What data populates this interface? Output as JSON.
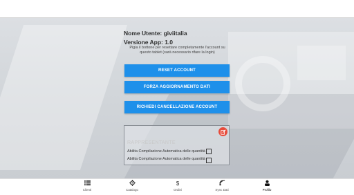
{
  "profile": {
    "username_line": "Nome Utente: giviitalia",
    "version_line": "Versione App: 1.0",
    "note": "Pigia il bottone per resettare completamente l'account su questo tablet (sarà necessario rifare la login)"
  },
  "actions": {
    "reset": "RESET ACCOUNT",
    "force_update": "FORZA AGGIORNAMENTO DATI",
    "request_delete": "RICHIEDI CANCELLAZIONE ACCOUNT"
  },
  "representatives": {
    "title": "RAPPRESENTANTE",
    "options": [
      "Abilita Compilazione Automatica delle quantità",
      "Abilita Compilazione Automatica delle quantità"
    ]
  },
  "nav": {
    "items": [
      {
        "label": "Clienti",
        "icon": "list-icon"
      },
      {
        "label": "Catalogo",
        "icon": "catalog-icon"
      },
      {
        "label": "Ordini",
        "icon": "dollar-icon"
      },
      {
        "label": "Sync Dati",
        "icon": "sync-icon"
      },
      {
        "label": "Profilo",
        "icon": "user-icon"
      }
    ],
    "active": "Profilo"
  },
  "colors": {
    "primary_button": "#1e90ea",
    "edit_button": "#e74c3c"
  }
}
